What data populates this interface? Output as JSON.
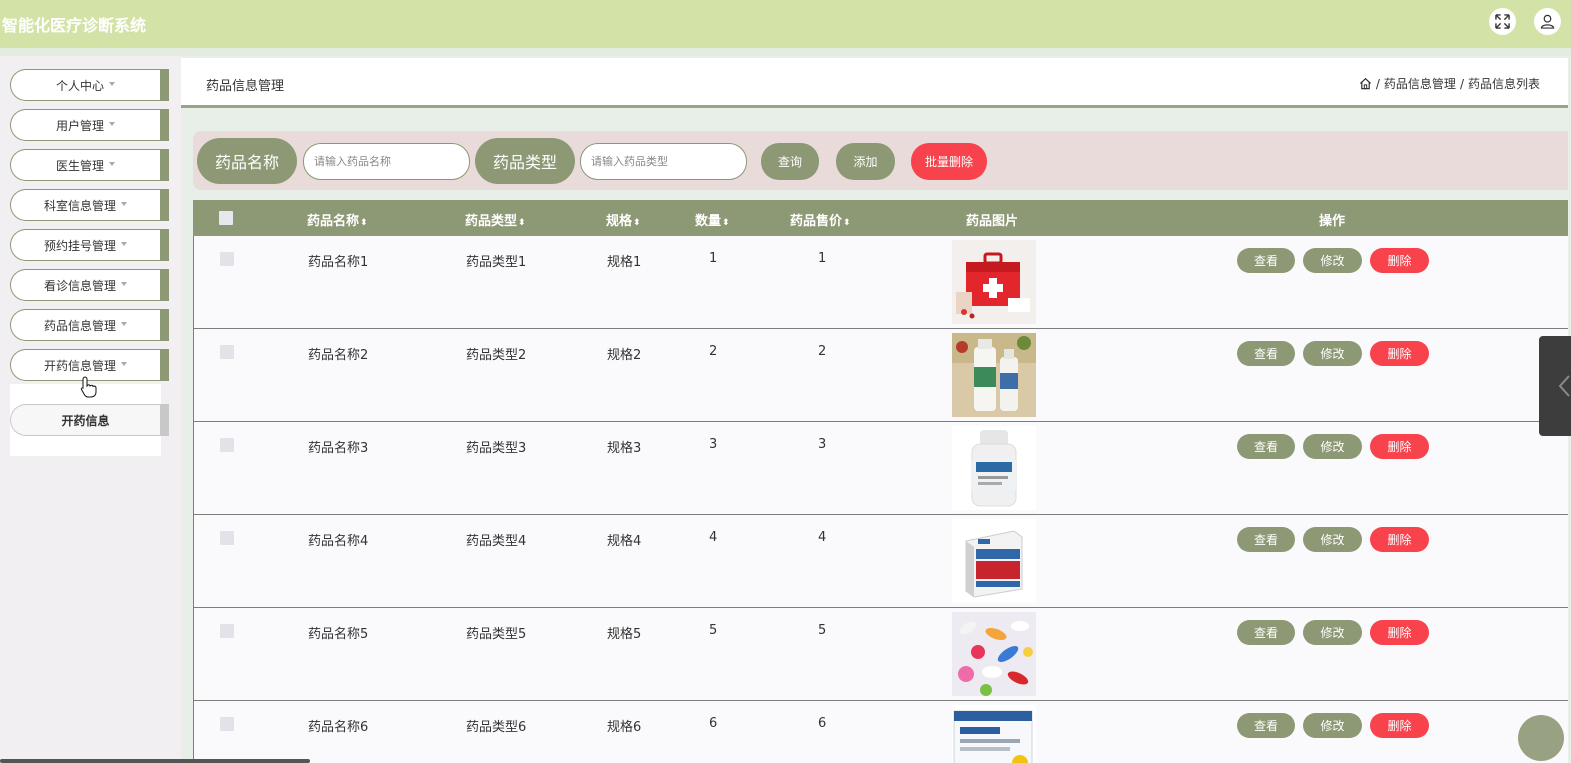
{
  "app": {
    "title": "智能化医疗诊断系统"
  },
  "header": {
    "fullscreen_icon": "fullscreen-icon",
    "user_icon": "user-icon"
  },
  "sidebar": {
    "items": [
      {
        "label": "个人中心"
      },
      {
        "label": "用户管理"
      },
      {
        "label": "医生管理"
      },
      {
        "label": "科室信息管理"
      },
      {
        "label": "预约挂号管理"
      },
      {
        "label": "看诊信息管理"
      },
      {
        "label": "药品信息管理"
      },
      {
        "label": "开药信息管理"
      }
    ],
    "submenu": {
      "label": "开药信息"
    }
  },
  "page": {
    "title": "药品信息管理",
    "breadcrumb": [
      "药品信息管理",
      "药品信息列表"
    ]
  },
  "search": {
    "name_label": "药品名称",
    "name_placeholder": "请输入药品名称",
    "type_label": "药品类型",
    "type_placeholder": "请输入药品类型",
    "query_button": "查询",
    "add_button": "添加",
    "batch_delete_button": "批量删除"
  },
  "table": {
    "columns": {
      "name": "药品名称",
      "type": "药品类型",
      "spec": "规格",
      "qty": "数量",
      "price": "药品售价",
      "image": "药品图片",
      "ops": "操作"
    },
    "sort_glyph": "⬍",
    "actions": {
      "view": "查看",
      "edit": "修改",
      "delete": "删除"
    },
    "rows": [
      {
        "name": "药品名称1",
        "type": "药品类型1",
        "spec": "规格1",
        "qty": "1",
        "price": "1",
        "image": "first-aid-kit"
      },
      {
        "name": "药品名称2",
        "type": "药品类型2",
        "spec": "规格2",
        "qty": "2",
        "price": "2",
        "image": "medicine-bottles"
      },
      {
        "name": "药品名称3",
        "type": "药品类型3",
        "spec": "规格3",
        "qty": "3",
        "price": "3",
        "image": "pill-bottle"
      },
      {
        "name": "药品名称4",
        "type": "药品类型4",
        "spec": "规格4",
        "qty": "4",
        "price": "4",
        "image": "medicine-box"
      },
      {
        "name": "药品名称5",
        "type": "药品类型5",
        "spec": "规格5",
        "qty": "5",
        "price": "5",
        "image": "pills"
      },
      {
        "name": "药品名称6",
        "type": "药品类型6",
        "spec": "规格6",
        "qty": "6",
        "price": "6",
        "image": "medicine-package"
      }
    ]
  },
  "colors": {
    "accent": "#8d9874",
    "danger": "#f8424c",
    "topbar": "#d3e3a8",
    "search_bg": "#e8dbd9"
  }
}
